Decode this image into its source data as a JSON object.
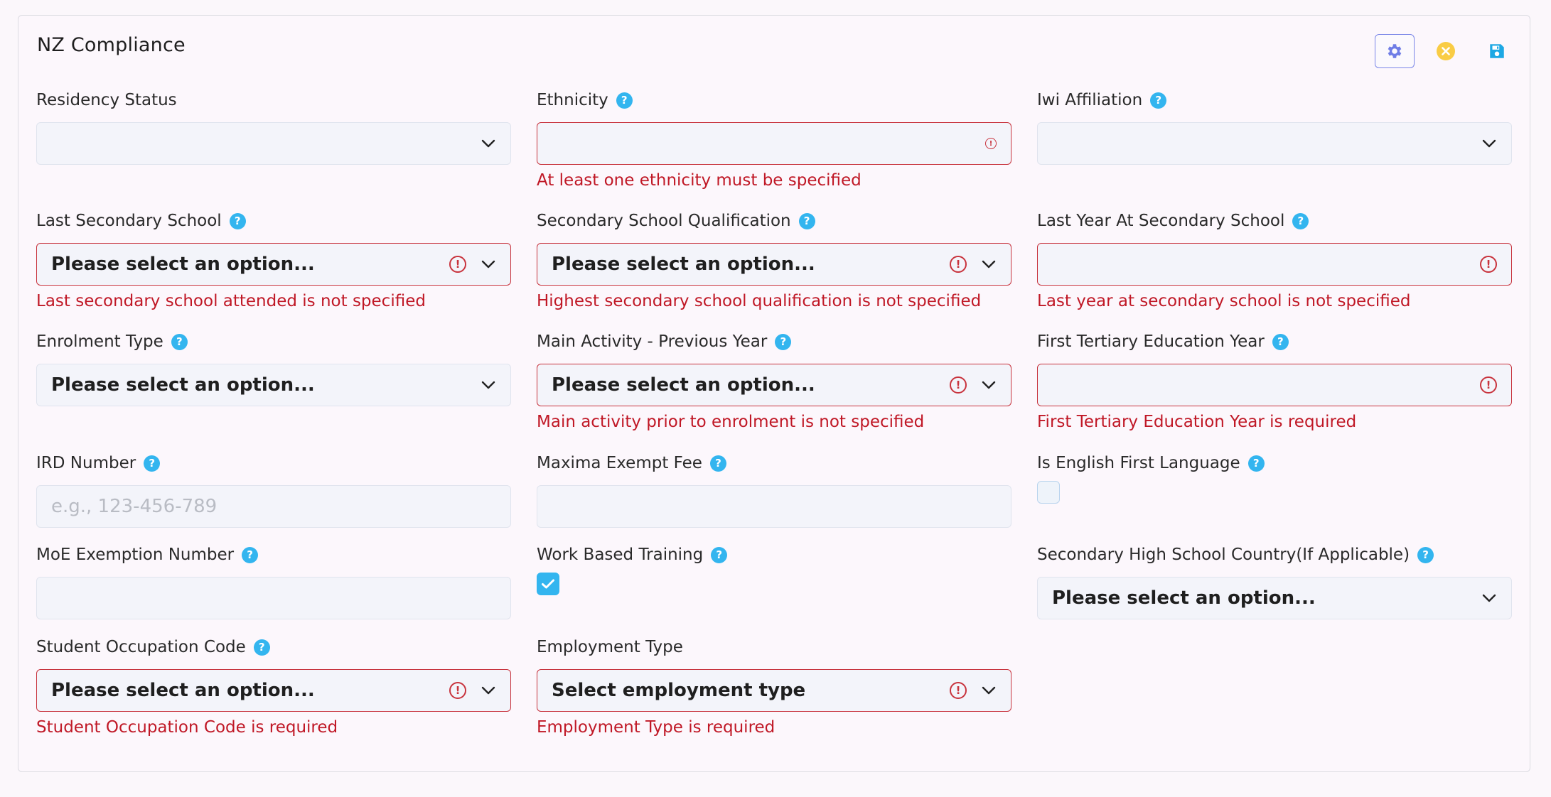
{
  "panel": {
    "title": "NZ Compliance"
  },
  "toolbar": {
    "settings_icon": "gear-icon",
    "cancel_icon": "close-circle-icon",
    "save_icon": "floppy-disk-icon"
  },
  "colors": {
    "error": "#c01826",
    "help": "#33b5ef",
    "warning": "#f9cc45",
    "accent": "#7b87e8"
  },
  "fields": {
    "residency_status": {
      "label": "Residency Status",
      "value": ""
    },
    "ethnicity": {
      "label": "Ethnicity",
      "value": "",
      "error": "At least one ethnicity must be specified"
    },
    "iwi_affiliation": {
      "label": "Iwi Affiliation",
      "value": ""
    },
    "last_secondary_school": {
      "label": "Last Secondary School",
      "value": "Please select an option...",
      "error": "Last secondary school attended is not specified"
    },
    "secondary_school_qualification": {
      "label": "Secondary School Qualification",
      "value": "Please select an option...",
      "error": "Highest secondary school qualification is not specified"
    },
    "last_year_at_secondary_school": {
      "label": "Last Year At Secondary School",
      "value": "",
      "error": "Last year at secondary school is not specified"
    },
    "enrolment_type": {
      "label": "Enrolment Type",
      "value": "Please select an option..."
    },
    "main_activity_previous_year": {
      "label": "Main Activity - Previous Year",
      "value": "Please select an option...",
      "error": "Main activity prior to enrolment is not specified"
    },
    "first_tertiary_education_year": {
      "label": "First Tertiary Education Year",
      "value": "",
      "error": "First Tertiary Education Year is required"
    },
    "ird_number": {
      "label": "IRD Number",
      "value": "",
      "placeholder": "e.g., 123-456-789"
    },
    "maxima_exempt_fee": {
      "label": "Maxima Exempt Fee",
      "value": ""
    },
    "is_english_first_language": {
      "label": "Is English First Language",
      "checked": false
    },
    "moe_exemption_number": {
      "label": "MoE Exemption Number",
      "value": ""
    },
    "work_based_training": {
      "label": "Work Based Training",
      "checked": true
    },
    "secondary_high_school_country": {
      "label": "Secondary High School Country(If Applicable)",
      "value": "Please select an option..."
    },
    "student_occupation_code": {
      "label": "Student Occupation Code",
      "value": "Please select an option...",
      "error": "Student Occupation Code is required"
    },
    "employment_type": {
      "label": "Employment Type",
      "value": "Select employment type",
      "error": "Employment Type is required"
    }
  }
}
